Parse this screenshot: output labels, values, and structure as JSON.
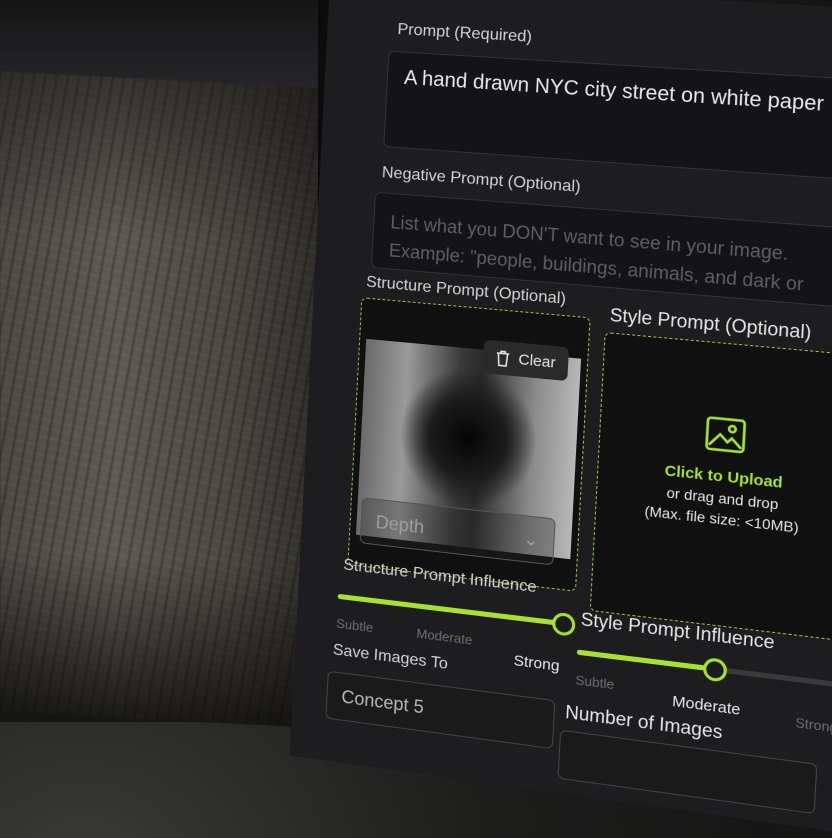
{
  "prompt": {
    "label": "Prompt (Required)",
    "value": "A hand drawn NYC city street on white paper"
  },
  "negative_prompt": {
    "label": "Negative Prompt (Optional)",
    "placeholder": "List what you DON'T want to see in your image. Example: \"people, buildings, animals, and dark or"
  },
  "structure_prompt": {
    "label": "Structure Prompt (Optional)",
    "clear_label": "Clear",
    "mode_select": "Depth"
  },
  "style_prompt": {
    "label": "Style Prompt (Optional)",
    "upload_cta": "Click to Upload",
    "upload_sub": "or drag and drop",
    "upload_limit": "(Max. file size: <10MB)"
  },
  "structure_influence": {
    "label": "Structure Prompt Influence",
    "ticks": [
      "Subtle",
      "Moderate",
      "Strong"
    ],
    "selected": "Strong",
    "value": 1.0
  },
  "style_influence": {
    "label": "Style Prompt Influence",
    "ticks": [
      "Subtle",
      "Moderate",
      "Strong"
    ],
    "selected": "Moderate",
    "value": 0.5
  },
  "save_images": {
    "label": "Save Images To",
    "value": "Concept 5"
  },
  "num_images": {
    "label": "Number of Images"
  },
  "colors": {
    "accent": "#a7e22e",
    "panel": "#1d1d1f",
    "text": "#e6e6e6"
  }
}
